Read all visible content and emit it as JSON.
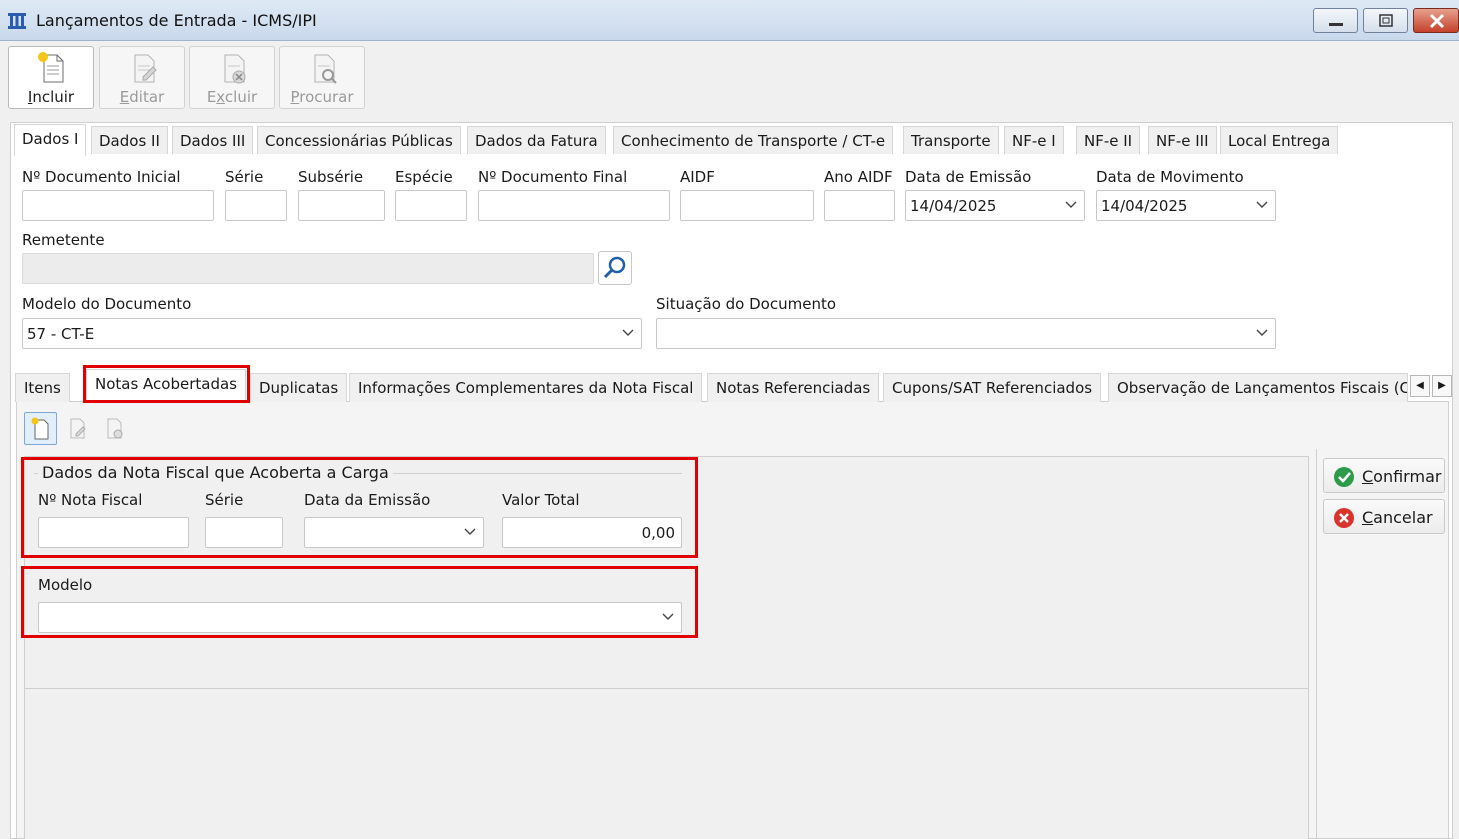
{
  "window": {
    "title": "Lançamentos de Entrada - ICMS/IPI"
  },
  "toolbar": {
    "incluir": {
      "label": "Incluir",
      "ul": "I",
      "rest": "ncluir"
    },
    "editar": {
      "label": "Editar",
      "ul": "E",
      "rest": "ditar"
    },
    "excluir": {
      "label": "Excluir",
      "ul": "x",
      "pre": "E",
      "rest": "cluir"
    },
    "procurar": {
      "label": "Procurar",
      "ul": "P",
      "rest": "rocurar"
    }
  },
  "tabs": [
    "Dados I",
    "Dados II",
    "Dados III",
    "Concessionárias Públicas",
    "Dados da Fatura",
    "Conhecimento de Transporte / CT-e",
    "Transporte",
    "NF-e I",
    "NF-e II",
    "NF-e III",
    "Local Entrega"
  ],
  "fields": {
    "doc_inicial": {
      "label": "Nº Documento Inicial",
      "value": ""
    },
    "serie": {
      "label": "Série",
      "value": ""
    },
    "subserie": {
      "label": "Subsérie",
      "value": ""
    },
    "especie": {
      "label": "Espécie",
      "value": ""
    },
    "doc_final": {
      "label": "Nº Documento Final",
      "value": ""
    },
    "aidf": {
      "label": "AIDF",
      "value": ""
    },
    "ano_aidf": {
      "label": "Ano AIDF",
      "value": ""
    },
    "data_emissao": {
      "label": "Data de Emissão",
      "value": "14/04/2025"
    },
    "data_movimento": {
      "label": "Data de Movimento",
      "value": "14/04/2025"
    },
    "remetente": {
      "label": "Remetente",
      "value": ""
    },
    "modelo_documento": {
      "label": "Modelo do Documento",
      "value": "57 - CT-E"
    },
    "situacao_documento": {
      "label": "Situação do Documento",
      "value": ""
    }
  },
  "subtabs": [
    "Itens",
    "Notas Acobertadas",
    "Duplicatas",
    "Informações Complementares da Nota Fiscal",
    "Notas Referenciadas",
    "Cupons/SAT Referenciados",
    "Observação de Lançamentos Fiscais (C"
  ],
  "nota": {
    "group_title": "Dados da Nota Fiscal que Acoberta a Carga",
    "nota_fiscal": {
      "label": "Nº Nota Fiscal",
      "value": ""
    },
    "serie": {
      "label": "Série",
      "value": ""
    },
    "data_emissao": {
      "label": "Data da Emissão",
      "value": ""
    },
    "valor_total": {
      "label": "Valor Total",
      "value": "0,00"
    },
    "modelo": {
      "label": "Modelo",
      "value": ""
    }
  },
  "actions": {
    "confirmar": {
      "ul": "C",
      "rest": "onfirmar"
    },
    "cancelar": {
      "ul": "C",
      "rest": "ancelar"
    }
  },
  "colors": {
    "highlight": "#e00000",
    "confirm": "#2e9b4a",
    "cancel": "#d9342b"
  }
}
